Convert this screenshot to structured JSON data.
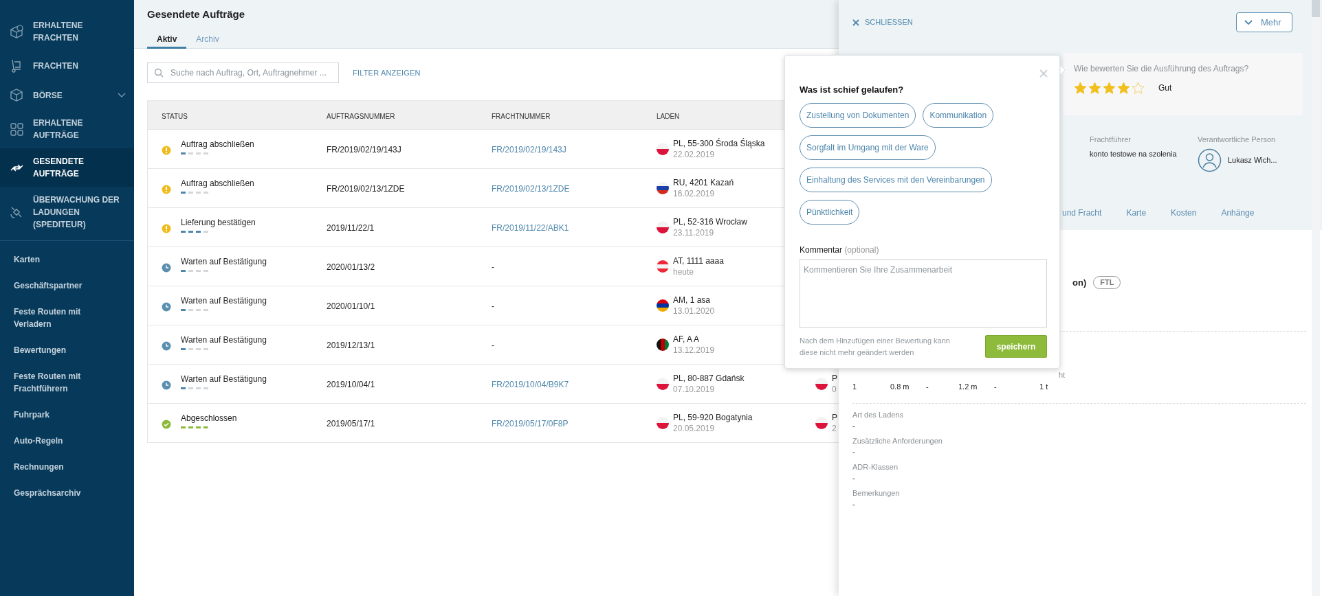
{
  "sidebar": {
    "main_items": [
      {
        "label": "ERHALTENE FRACHTEN",
        "selected": false,
        "has_submenu": false
      },
      {
        "label": "FRACHTEN",
        "selected": false,
        "has_submenu": false
      },
      {
        "label": "BÖRSE",
        "selected": false,
        "has_submenu": true
      },
      {
        "label": "ERHALTENE AUFTRÄGE",
        "selected": false,
        "has_submenu": false
      },
      {
        "label": "GESENDETE AUFTRÄGE",
        "selected": true,
        "has_submenu": false
      },
      {
        "label": "ÜBERWACHUNG DER LADUNGEN (SPEDITEUR)",
        "selected": false,
        "has_submenu": false
      }
    ],
    "items": [
      "Karten",
      "Geschäftspartner",
      "Feste Routen mit Verladern",
      "Bewertungen",
      "Feste Routen mit Frachtführern",
      "Fuhrpark",
      "Auto-Regeln",
      "Rechnungen",
      "Gesprächsarchiv"
    ]
  },
  "page": {
    "title": "Gesendete Aufträge",
    "tabs": [
      {
        "label": "Aktiv",
        "selected": true
      },
      {
        "label": "Archiv",
        "selected": false
      }
    ],
    "search": {
      "placeholder": "Suche nach Auftrag, Ort, Auftragnehmer ..."
    },
    "filter_link": "FILTER ANZEIGEN"
  },
  "table": {
    "columns": [
      "STATUS",
      "AUFTRAGSNUMMER",
      "FRACHTNUMMER",
      "LADEN"
    ],
    "rows": [
      {
        "status": {
          "kind": "warning",
          "label": "Auftrag abschließen",
          "level": 0.25
        },
        "order_no": "FR/2019/02/19/143J",
        "freight_no": "FR/2019/02/19/143J",
        "loading": {
          "kind": "pl",
          "place": "PL, 55-300 Środa Śląska",
          "date": "22.02.2019"
        }
      },
      {
        "status": {
          "kind": "warning",
          "label": "Auftrag abschließen",
          "level": 0.25
        },
        "order_no": "FR/2019/02/13/1ZDE",
        "freight_no": "FR/2019/02/13/1ZDE",
        "loading": {
          "kind": "ru",
          "place": "RU, 4201 Kazań",
          "date": "16.02.2019"
        }
      },
      {
        "status": {
          "kind": "warning",
          "label": "Lieferung bestätigen",
          "level": 0.75
        },
        "order_no": "2019/11/22/1",
        "freight_no": "FR/2019/11/22/ABK1",
        "loading": {
          "kind": "pl",
          "place": "PL, 52-316 Wrocław",
          "date": "23.11.2019"
        }
      },
      {
        "status": {
          "kind": "pending",
          "label": "Warten auf Bestätigung",
          "level": 0.25
        },
        "order_no": "2020/01/13/2",
        "freight_no": "-",
        "loading": {
          "kind": "at",
          "place": "AT, 1111 aaaa",
          "date": "heute"
        }
      },
      {
        "status": {
          "kind": "pending",
          "label": "Warten auf Bestätigung",
          "level": 0.25
        },
        "order_no": "2020/01/10/1",
        "freight_no": "-",
        "loading": {
          "kind": "am",
          "place": "AM, 1 asa",
          "date": "13.01.2020"
        }
      },
      {
        "status": {
          "kind": "pending",
          "label": "Warten auf Bestätigung",
          "level": 0.25
        },
        "order_no": "2019/12/13/1",
        "freight_no": "-",
        "loading": {
          "kind": "af",
          "place": "AF, A A",
          "date": "13.12.2019"
        }
      },
      {
        "status": {
          "kind": "pending",
          "label": "Warten auf Bestätigung",
          "level": 0.25
        },
        "order_no": "2019/10/04/1",
        "freight_no": "FR/2019/10/04/B9K7",
        "loading": {
          "kind": "pl",
          "place": "PL, 80-887 Gdańsk",
          "date": "07.10.2019"
        },
        "unloading": {
          "kind": "pl",
          "place": "P",
          "date": "0"
        }
      },
      {
        "status": {
          "kind": "done",
          "label": "Abgeschlossen",
          "level": 1
        },
        "order_no": "2019/05/17/1",
        "freight_no": "FR/2019/05/17/0F8P",
        "loading": {
          "kind": "pl",
          "place": "PL, 59-920 Bogatynia",
          "date": "20.05.2019"
        },
        "unloading": {
          "kind": "pl",
          "place": "P",
          "date": "2"
        }
      }
    ]
  },
  "detail_panel": {
    "close_label": "SCHLIESSEN",
    "more_button": "Mehr",
    "rating": {
      "question": "Wie bewerten Sie die Ausführung des Auftrags?",
      "stars": 4,
      "label": "Gut"
    },
    "carrier": {
      "label": "Frachtführer",
      "value": "konto testowe na szolenia"
    },
    "responsible": {
      "label": "Verantwortliche Person",
      "name": "Lukasz Wich..."
    },
    "tabs": [
      {
        "label": "und Fracht",
        "selected": false
      },
      {
        "label": "Karte",
        "selected": false
      },
      {
        "label": "Kosten",
        "selected": false
      },
      {
        "label": "Anhänge",
        "selected": false
      }
    ],
    "heading_fragment": "on)",
    "badge": "FTL",
    "dimensions": {
      "header_fragment": "ht",
      "values": [
        "1",
        "0.8 m",
        "-",
        "1.2 m",
        "-",
        "1 t"
      ]
    },
    "fields": [
      {
        "label": "Art des Ladens",
        "value": "-"
      },
      {
        "label": "Zusätzliche Anforderungen",
        "value": "-"
      },
      {
        "label": "ADR-Klassen",
        "value": "-"
      },
      {
        "label": "Bemerkungen",
        "value": "-"
      }
    ]
  },
  "rating_popup": {
    "title": "Was ist schief gelaufen?",
    "chips": [
      {
        "label": "Zustellung von Dokumenten",
        "selected": false
      },
      {
        "label": "Kommunikation",
        "selected": false
      },
      {
        "label": "Sorgfalt im Umgang mit der Ware",
        "selected": false
      },
      {
        "label": "Einhaltung des Services mit den Vereinbarungen",
        "selected": false
      },
      {
        "label": "Pünktlichkeit",
        "selected": false
      }
    ],
    "comment_label": "Kommentar",
    "comment_hint": "(optional)",
    "placeholder": "Kommentieren Sie Ihre Zusammenarbeit",
    "note": "Nach dem Hinzufügen einer Bewertung kann diese nicht mehr geändert werden",
    "save_button": "speichern"
  }
}
